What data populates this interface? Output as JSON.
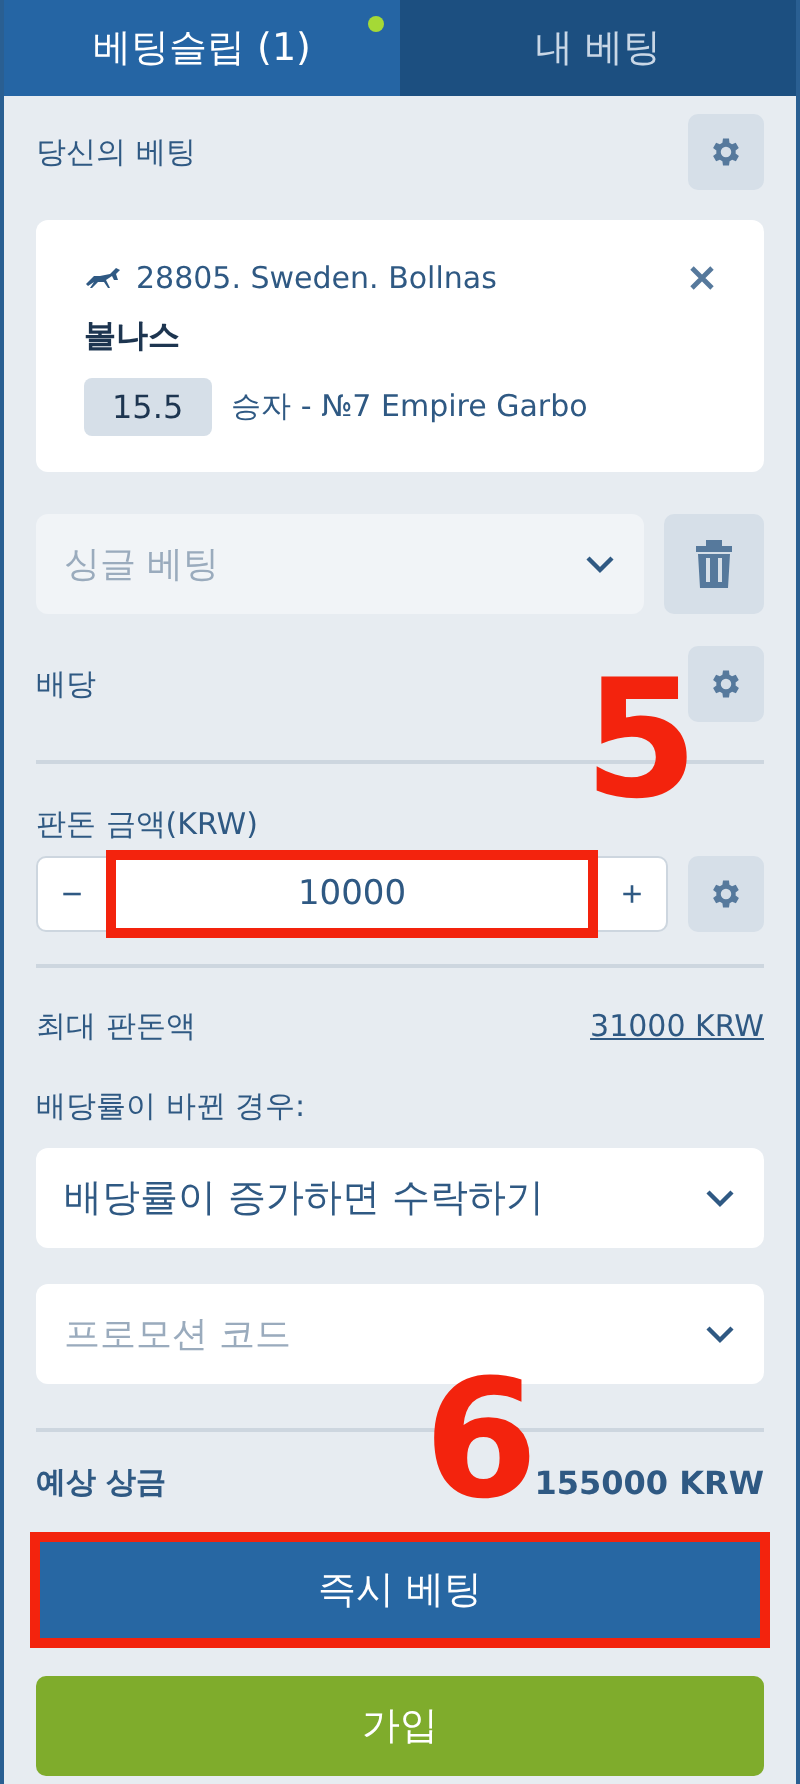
{
  "tabs": [
    {
      "label": "베팅슬립 (1)",
      "selected": true,
      "dot": true
    },
    {
      "label": "내 베팅",
      "selected": false,
      "dot": false
    }
  ],
  "your_bets": {
    "title": "당신의 베팅"
  },
  "bet": {
    "event": "28805. Sweden. Bollnas",
    "name": "볼나스",
    "odds": "15.5",
    "selection": "승자 - №7 Empire Garbo"
  },
  "bet_type": {
    "value": "싱글 베팅"
  },
  "odds_row": {
    "label": "배당",
    "annotation": "5"
  },
  "stake": {
    "label": "판돈 금액(KRW)",
    "minus": "−",
    "value": "10000",
    "plus": "+",
    "highlighted": true
  },
  "max_stake": {
    "label": "최대 판돈액",
    "value": "31000 KRW"
  },
  "odds_change": {
    "label": "배당률이 바뀐 경우:",
    "value": "배당률이 증가하면 수락하기"
  },
  "promo": {
    "placeholder": "프로모션 코드"
  },
  "potential_win": {
    "label": "예상 상금",
    "value": "155000 KRW",
    "annotation": "6"
  },
  "place_bet": {
    "label": "즉시 베팅",
    "highlighted": true
  },
  "register": {
    "label": "가입"
  }
}
